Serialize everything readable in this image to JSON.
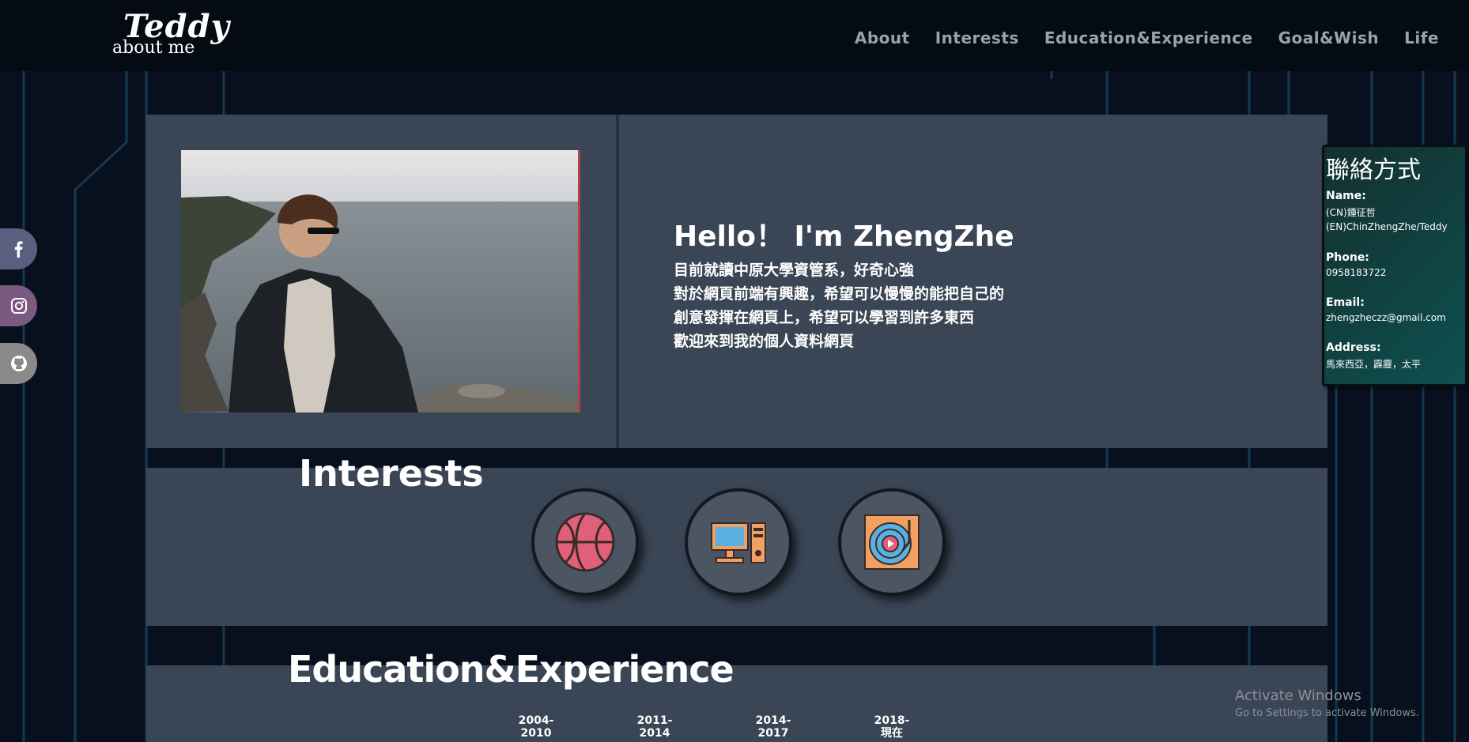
{
  "nav": {
    "logo_title": "Teddy",
    "logo_sub": "about me",
    "links": [
      "About",
      "Interests",
      "Education&Experience",
      "Goal&Wish",
      "Life"
    ]
  },
  "social": [
    "facebook-icon",
    "instagram-icon",
    "github-icon"
  ],
  "about": {
    "hello": "Hello！ I'm ZhengZhe",
    "bio": [
      "目前就讀中原大學資管系，好奇心強",
      "對於網頁前端有興趣，希望可以慢慢的能把自己的",
      "創意發揮在網頁上，希望可以學習到許多東西",
      "歡迎來到我的個人資料網頁"
    ]
  },
  "interests": {
    "title": "Interests",
    "icons": [
      "basketball-icon",
      "computer-icon",
      "turntable-icon"
    ]
  },
  "education": {
    "title": "Education&Experience",
    "years": [
      {
        "line1": "2004-",
        "line2": "2010"
      },
      {
        "line1": "2011-",
        "line2": "2014"
      },
      {
        "line1": "2014-",
        "line2": "2017"
      },
      {
        "line1": "2018-",
        "line2": "現在"
      }
    ]
  },
  "contact": {
    "title": "聯絡方式",
    "name_label": "Name:",
    "name_cn": "(CN)鍾征哲",
    "name_en": "(EN)ChinZhengZhe/Teddy",
    "phone_label": "Phone:",
    "phone": "0958183722",
    "email_label": "Email:",
    "email": "zhengzheczz@gmail.com",
    "address_label": "Address:",
    "address": "馬來西亞，霹靂，太平"
  },
  "watermark": {
    "line1": "Activate Windows",
    "line2": "Go to Settings to activate Windows."
  },
  "colors": {
    "panel": "#3a4555",
    "nav": "#050b12",
    "contact_teal": "#0e5050",
    "facebook": "#5a5f80",
    "instagram": "#7a5a80",
    "github": "#8a8a8a"
  }
}
